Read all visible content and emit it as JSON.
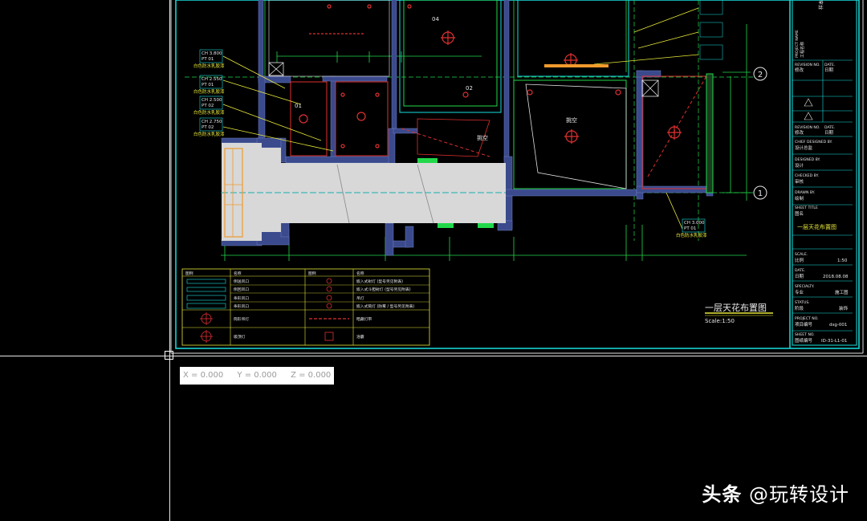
{
  "drawing": {
    "title": "一层天花布置图",
    "scale": "Scale:1:50",
    "axis_markers": [
      "2",
      "1"
    ],
    "room_labels": [
      "挑空",
      "挑空",
      "01",
      "02",
      "04"
    ],
    "ceiling_tags": [
      [
        "CH 3.800",
        "PT 01",
        "白色防水乳胶漆"
      ],
      [
        "CH 2.550",
        "PT 01",
        "白色防水乳胶漆"
      ],
      [
        "CH 2.500",
        "PT 02",
        "白色防水乳胶漆"
      ],
      [
        "CH 2.750",
        "PT 02",
        "白色防水乳胶漆"
      ],
      [
        "CH 3.000",
        "PT 01",
        "白色防水乳胶漆"
      ]
    ]
  },
  "legend": {
    "headers": [
      "图例",
      "名称",
      "图例",
      "名称"
    ],
    "rows": [
      [
        "侧送风口",
        "嵌入式射灯 (型号另见附表)"
      ],
      [
        "侧回风口",
        "嵌入式斗胆射灯 (型号另见附表)"
      ],
      [
        "条形风口",
        "吊灯"
      ],
      [
        "条形风口",
        "嵌入式筒灯 (防雾 / 型号另见附表)"
      ],
      [
        "筒形吊灯",
        "暗藏灯带"
      ],
      [
        "吸顶灯",
        "浴霸"
      ]
    ]
  },
  "title_block": {
    "project_name_label": "PROJECT NAME",
    "project_name": "工程名称",
    "revision_label": "REVISION NO.",
    "revision": "修改",
    "date_label": "DATE.",
    "date_short": "日期",
    "chief_label": "CHIEF DESIGNED BY.",
    "chief": "设计总监",
    "designed_label": "DESIGNED BY.",
    "designed": "设计",
    "checked_label": "CHECKED BY.",
    "checked": "审核",
    "drawn_label": "DRAWN BY.",
    "drawn": "绘制",
    "sheet_title_label": "SHEET TITLE",
    "sheet_title": "图名",
    "sheet_title_value": "一层天花布置图",
    "scale_label": "SCALE.",
    "scale_cn": "比例",
    "scale_value": "1:50",
    "date2_label": "DATE.",
    "date2_cn": "日期",
    "date_value": "2018.08.08",
    "specialty_label": "SPECIALTY.",
    "specialty_cn": "专业",
    "specialty_value": "施工图",
    "status_label": "STATUS.",
    "status_cn": "阶段",
    "status_value": "装饰",
    "project_no_label": "PROJECT NO.",
    "project_no_cn": "项目编号",
    "project_no_value": "dsg-001",
    "sheet_no_label": "SHEET NO.",
    "sheet_no_cn": "图纸编号",
    "sheet_no_value": "ID-31-L1-01",
    "top_tag": "样本"
  },
  "status_bar": {
    "x": "X = 0.000",
    "y": "Y = 0.000",
    "z": "Z = 0.000"
  },
  "watermark": {
    "brand": "头条",
    "handle": "@玩转设计"
  },
  "colors": {
    "background": "#000000",
    "cyan": "#19e0e0",
    "green": "#22d84a",
    "yellow": "#e8e83a",
    "red": "#e03030",
    "wall_fill": "#3a4a8c",
    "floor_fill": "#d8d8d8",
    "orange": "#f09a2c"
  }
}
